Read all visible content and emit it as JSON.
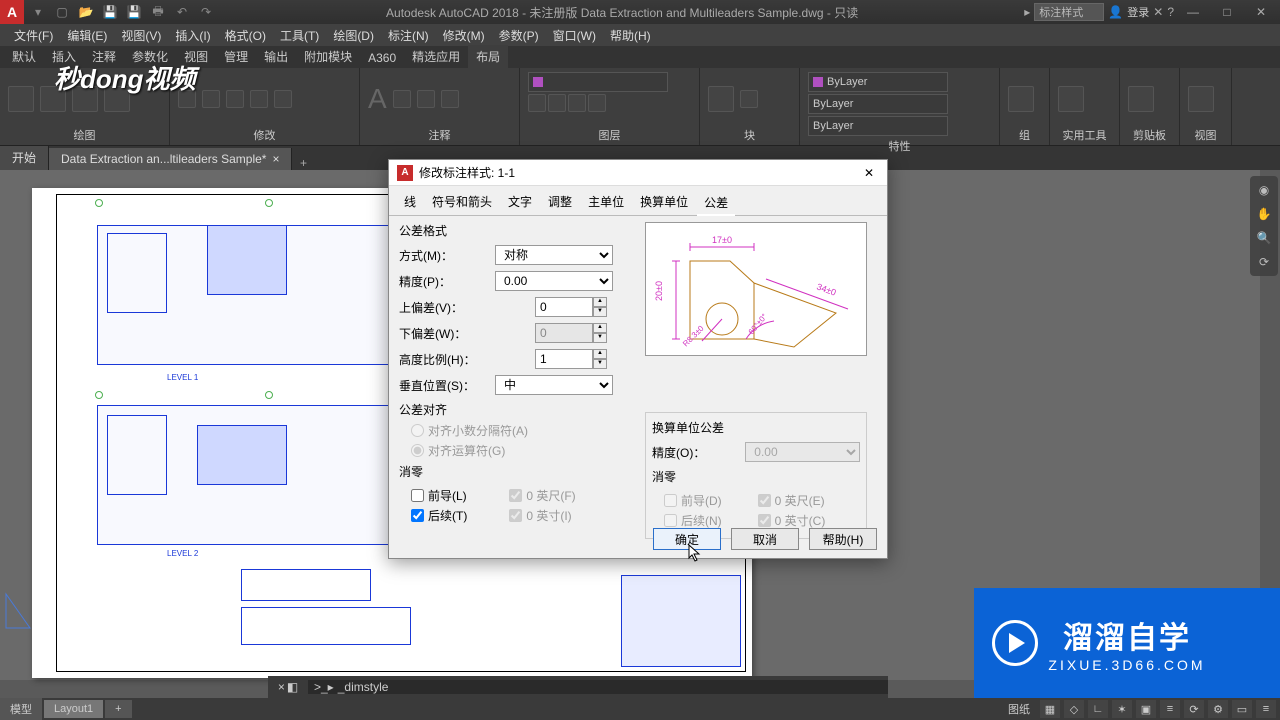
{
  "title": "Autodesk AutoCAD 2018 - 未注册版   Data Extraction and Multileaders Sample.dwg - 只读",
  "title_search": "标注样式",
  "login": "登录",
  "menus": [
    "文件(F)",
    "编辑(E)",
    "视图(V)",
    "插入(I)",
    "格式(O)",
    "工具(T)",
    "绘图(D)",
    "标注(N)",
    "修改(M)",
    "参数(P)",
    "窗口(W)",
    "帮助(H)"
  ],
  "ribbon_tabs": [
    "默认",
    "插入",
    "注释",
    "参数化",
    "视图",
    "管理",
    "输出",
    "附加模块",
    "A360",
    "精选应用",
    "布局"
  ],
  "ribbon_active": "布局",
  "ribbon_groups": [
    "绘图",
    "修改",
    "注释",
    "图层",
    "块",
    "特性",
    "组",
    "实用工具",
    "剪贴板",
    "视图"
  ],
  "bylayer": "ByLayer",
  "doc_tabs": {
    "start": "开始",
    "file": "Data Extraction an...ltileaders Sample*"
  },
  "sd_logo": "秒dong视频",
  "level1": "LEVEL 1",
  "level2": "LEVEL 2",
  "dialog": {
    "title": "修改标注样式: 1-1",
    "tabs": [
      "线",
      "符号和箭头",
      "文字",
      "调整",
      "主单位",
      "换算单位",
      "公差"
    ],
    "active_tab": "公差",
    "sec_format": "公差格式",
    "method": "方式(M)：",
    "method_v": "对称",
    "precision": "精度(P)：",
    "precision_v": "0.00",
    "upper": "上偏差(V)：",
    "upper_v": "0",
    "lower": "下偏差(W)：",
    "lower_v": "0",
    "hratio": "高度比例(H)：",
    "hratio_v": "1",
    "vpos": "垂直位置(S)：",
    "vpos_v": "中",
    "sec_align": "公差对齐",
    "align_dec": "对齐小数分隔符(A)",
    "align_op": "对齐运算符(G)",
    "sec_zero": "消零",
    "lead": "前导(L)",
    "trail": "后续(T)",
    "feet": "0 英尺(F)",
    "inch": "0 英寸(I)",
    "sec_alt": "换算单位公差",
    "alt_prec": "精度(O)：",
    "alt_prec_v": "0.00",
    "sec_alt_zero": "消零",
    "alt_lead": "前导(D)",
    "alt_trail": "后续(N)",
    "alt_feet": "0 英尺(E)",
    "alt_inch": "0 英寸(C)",
    "ok": "确定",
    "cancel": "取消",
    "help": "帮助(H)"
  },
  "preview_dims": {
    "top": "17±0",
    "left": "20±0",
    "angle": "60°±0°",
    "rad": "R8.3±0",
    "diag": "34±0"
  },
  "cmd": "_dimstyle",
  "cmd_prefix": ">_▸",
  "bottom_tabs": [
    "模型",
    "Layout1"
  ],
  "status_label": "图纸",
  "brand": {
    "big": "溜溜自学",
    "small": "ZIXUE.3D66.COM"
  }
}
